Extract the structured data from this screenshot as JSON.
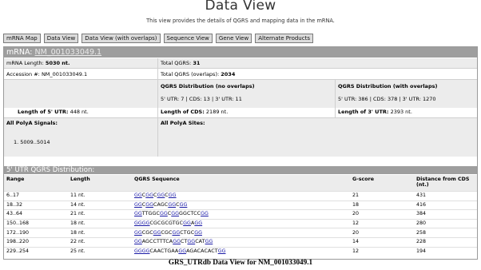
{
  "page": {
    "title": "Data View",
    "subtitle": "This view provides the details of QGRS and mapping data in the mRNA."
  },
  "buttons": [
    "mRNA Map",
    "Data View",
    "Data View (with overlaps)",
    "Sequence View",
    "Gene View",
    "Alternate Products"
  ],
  "mrna": {
    "header_label": "mRNA:",
    "accession_link": "NM_001033049.1",
    "length_label": "mRNA Length:",
    "length_value": "5030 nt.",
    "accession_label": "Accession #:",
    "accession_value": "NM_001033049.1",
    "total_qgrs_label": "Total QGRS:",
    "total_qgrs_value": "31",
    "total_overlaps_label": "Total QGRS (overlaps):",
    "total_overlaps_value": "2034",
    "dist_no_overlap_title": "QGRS Distribution (no overlaps)",
    "dist_no_overlap_values": "5' UTR: 7  |  CDS: 13  |  3' UTR: 11",
    "dist_overlap_title": "QGRS Distribution (with overlaps)",
    "dist_overlap_values": "5' UTR: 386  |  CDS: 378  |  3' UTR: 1270",
    "utr5_label": "Length of 5' UTR:",
    "utr5_value": "448 nt.",
    "cds_label": "Length of CDS:",
    "cds_value": "2189 nt.",
    "utr3_label": "Length of 3' UTR:",
    "utr3_value": "2393 nt.",
    "polya_signals_label": "All PolyA Signals:",
    "polya_signal_item": "1.   5009..5014",
    "polya_sites_label": "All PolyA Sites:"
  },
  "utr_section": {
    "title": "5' UTR QGRS Distribution:",
    "columns": [
      "Range",
      "Length",
      "QGRS Sequence",
      "G-score",
      "Distance from CDS (nt.)"
    ],
    "rows": [
      {
        "range": "6..17",
        "length": "11 nt.",
        "seq": [
          [
            "GG",
            1
          ],
          [
            "C",
            0
          ],
          [
            "GG",
            1
          ],
          [
            "C",
            0
          ],
          [
            "GG",
            1
          ],
          [
            "C",
            0
          ],
          [
            "GG",
            1
          ]
        ],
        "gscore": "21",
        "dist": "431"
      },
      {
        "range": "18..32",
        "length": "14 nt.",
        "seq": [
          [
            "GG",
            1
          ],
          [
            "C",
            0
          ],
          [
            "GG",
            1
          ],
          [
            "CAGC",
            0
          ],
          [
            "GG",
            1
          ],
          [
            "C",
            0
          ],
          [
            "GG",
            1
          ]
        ],
        "gscore": "18",
        "dist": "416"
      },
      {
        "range": "43..64",
        "length": "21 nt.",
        "seq": [
          [
            "GG",
            1
          ],
          [
            "TTGGC",
            0
          ],
          [
            "GG",
            1
          ],
          [
            "C",
            0
          ],
          [
            "GG",
            1
          ],
          [
            "GGCTCC",
            0
          ],
          [
            "GG",
            1
          ]
        ],
        "gscore": "20",
        "dist": "384"
      },
      {
        "range": "150..168",
        "length": "18 nt.",
        "seq": [
          [
            "GGGG",
            1
          ],
          [
            "CGCGCGTGC",
            0
          ],
          [
            "GG",
            1
          ],
          [
            "A",
            0
          ],
          [
            "GG",
            1
          ]
        ],
        "gscore": "12",
        "dist": "280"
      },
      {
        "range": "172..190",
        "length": "18 nt.",
        "seq": [
          [
            "GG",
            1
          ],
          [
            "CGC",
            0
          ],
          [
            "GG",
            1
          ],
          [
            "CGC",
            0
          ],
          [
            "GG",
            1
          ],
          [
            "CTGC",
            0
          ],
          [
            "GG",
            1
          ]
        ],
        "gscore": "20",
        "dist": "258"
      },
      {
        "range": "198..220",
        "length": "22 nt.",
        "seq": [
          [
            "GG",
            1
          ],
          [
            "AGCCTTTCA",
            0
          ],
          [
            "GG",
            1
          ],
          [
            "CT",
            0
          ],
          [
            "GG",
            1
          ],
          [
            "CAT",
            0
          ],
          [
            "GG",
            1
          ]
        ],
        "gscore": "14",
        "dist": "228"
      },
      {
        "range": "229..254",
        "length": "25 nt.",
        "seq": [
          [
            "GGGG",
            1
          ],
          [
            "CAACTGAA",
            0
          ],
          [
            "GG",
            1
          ],
          [
            "AGACACACT",
            0
          ],
          [
            "GG",
            1
          ]
        ],
        "gscore": "12",
        "dist": "194"
      }
    ]
  },
  "caption": "GRS_UTRdb Data View for NM_001033049.1"
}
